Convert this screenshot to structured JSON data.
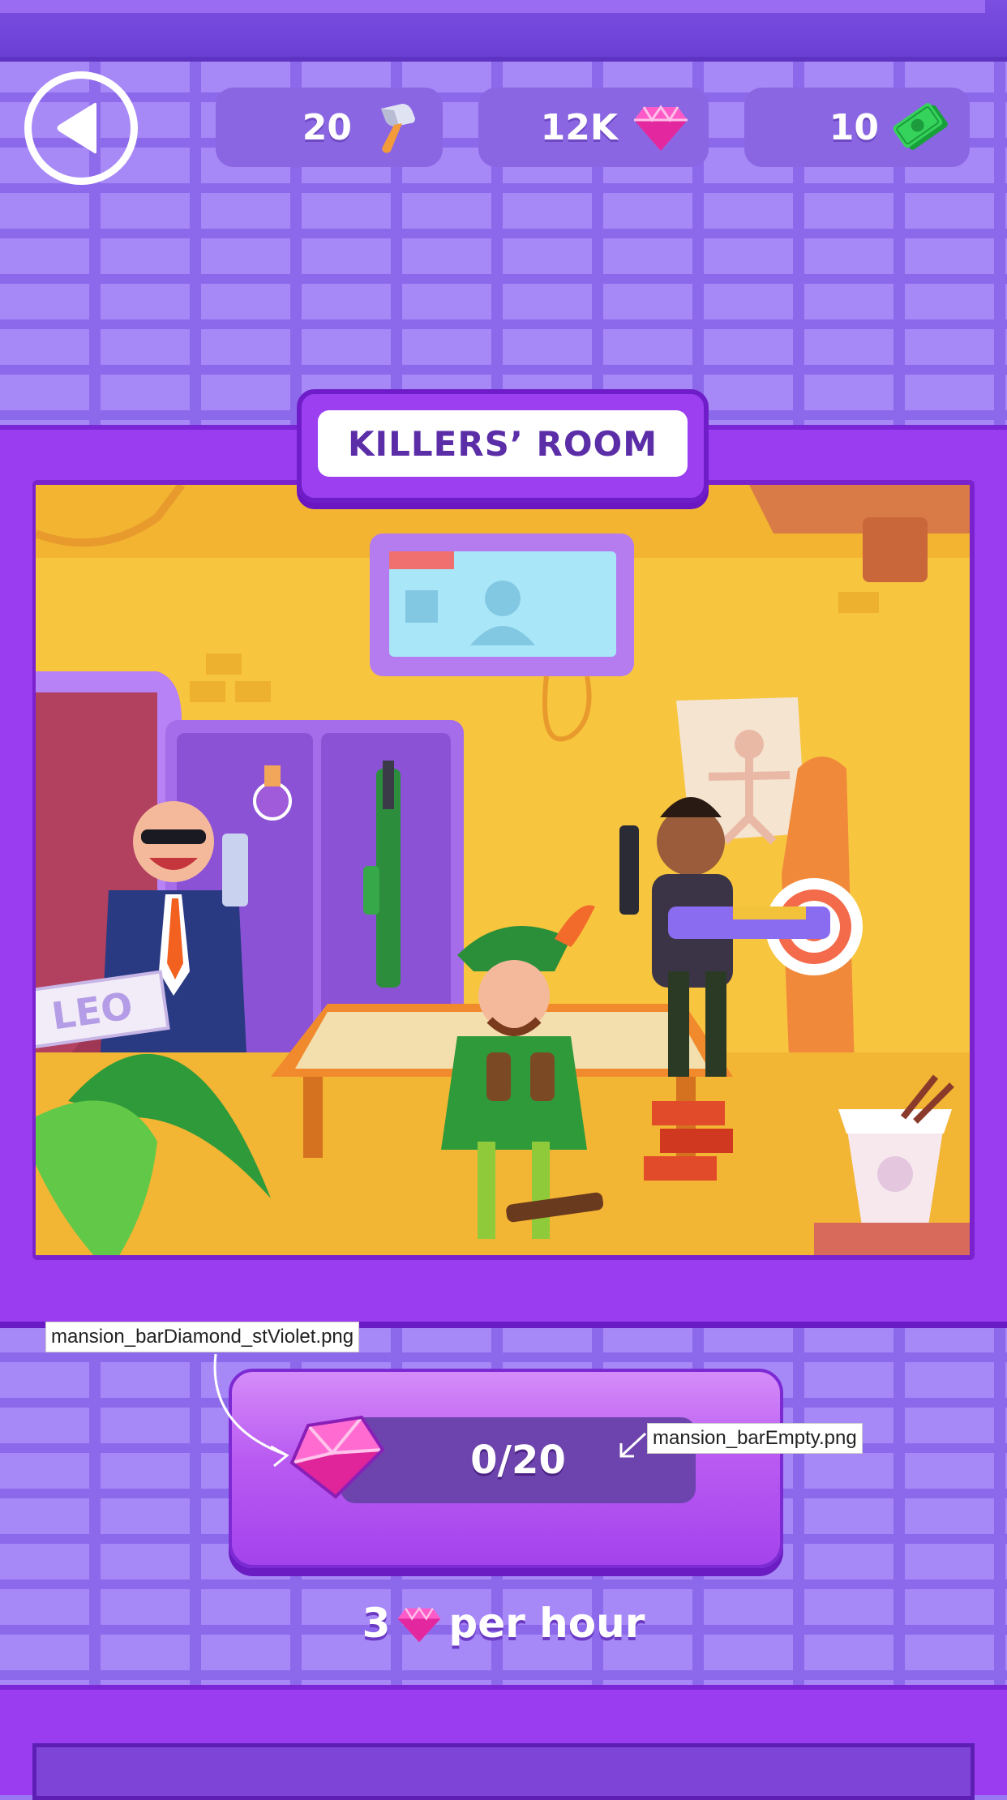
{
  "currency": {
    "hammers": {
      "value": "20",
      "icon": "hammer-icon"
    },
    "gems": {
      "value": "12K",
      "icon": "gem-icon"
    },
    "cash": {
      "value": "10",
      "icon": "cash-icon"
    }
  },
  "room": {
    "title": "KILLERS’ ROOM",
    "sign_text": "LEO"
  },
  "progress": {
    "text": "0/20",
    "current": 0,
    "max": 20,
    "fill_fraction": 0
  },
  "annotations": {
    "diamond_file": "mansion_barDiamond_stViolet.png",
    "empty_bar_file": "mansion_barEmpty.png"
  },
  "rate": {
    "amount": "3",
    "unit": "per hour"
  },
  "colors": {
    "background": "#9b78f3",
    "frame": "#9a3df0",
    "accent_gem": "#e6319f",
    "title_text": "#5b2ea8"
  }
}
